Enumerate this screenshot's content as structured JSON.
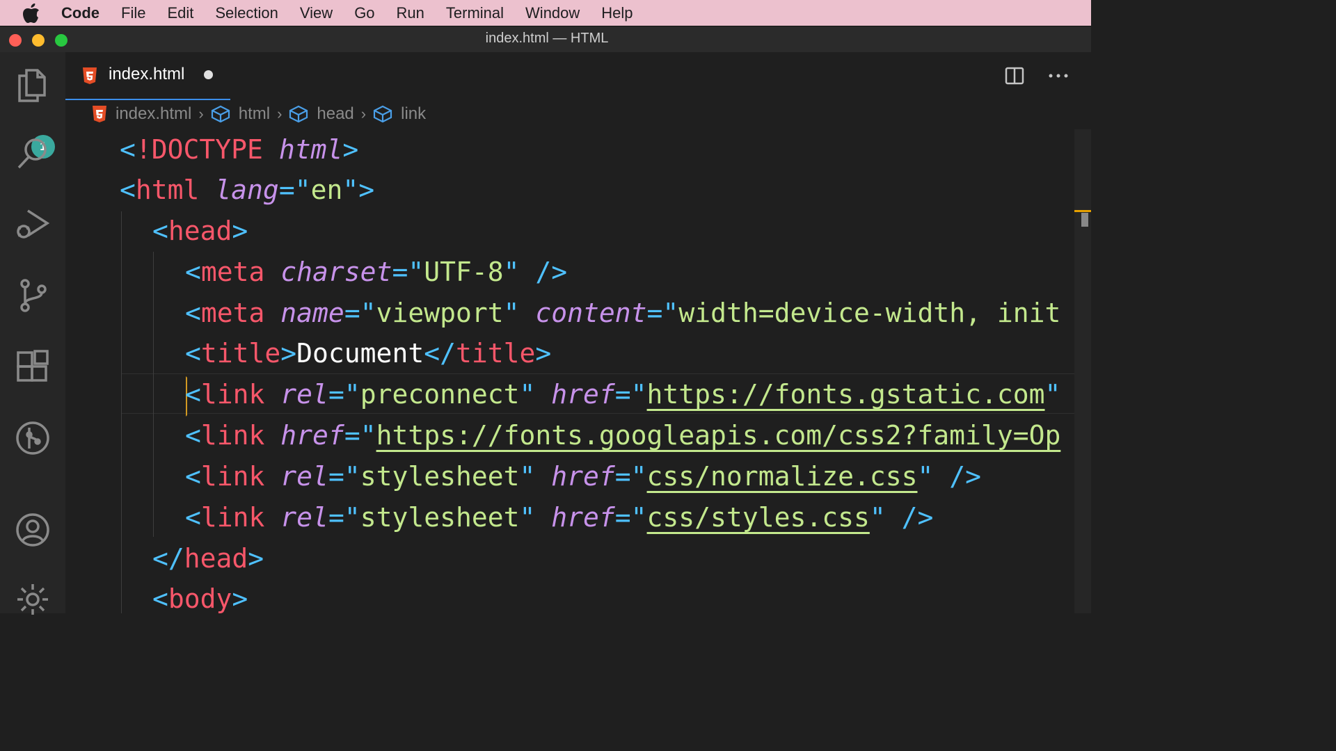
{
  "menubar": {
    "app": "Code",
    "items": [
      "File",
      "Edit",
      "Selection",
      "View",
      "Go",
      "Run",
      "Terminal",
      "Window",
      "Help"
    ]
  },
  "window": {
    "title": "index.html — HTML"
  },
  "activity_bar": {
    "explorer_badge": "1",
    "icons": [
      "files-icon",
      "search-icon",
      "run-debug-icon",
      "source-control-icon",
      "extensions-icon",
      "git-graph-icon",
      "account-icon",
      "gear-icon"
    ]
  },
  "tab": {
    "label": "index.html",
    "modified": true
  },
  "breadcrumb": {
    "file": "index.html",
    "items": [
      "html",
      "head",
      "link"
    ]
  },
  "code_lines": [
    "<!DOCTYPE html>",
    "<html lang=\"en\">",
    "<head>",
    "<meta charset=\"UTF-8\" />",
    "<meta name=\"viewport\" content=\"width=device-width, init",
    "<title>Document</title>",
    "<link rel=\"preconnect\" href=\"https://fonts.gstatic.com\"",
    "<link href=\"https://fonts.googleapis.com/css2?family=Op",
    "<link rel=\"stylesheet\" href=\"css/normalize.css\" />",
    "<link rel=\"stylesheet\" href=\"css/styles.css\" />",
    "</head>",
    "<body>"
  ],
  "tokens": {
    "doctype": "!DOCTYPE",
    "html": "html",
    "lang": "lang",
    "en": "en",
    "head": "head",
    "meta": "meta",
    "charset": "charset",
    "utf8": "UTF-8",
    "name": "name",
    "viewport": "viewport",
    "content": "content",
    "content_val": "width=device-width, init",
    "title": "title",
    "document": "Document",
    "link": "link",
    "rel": "rel",
    "href": "href",
    "preconnect": "preconnect",
    "gstatic": "https://fonts.gstatic.com",
    "googleapis": "https://fonts.googleapis.com/css2?family=Op",
    "stylesheet": "stylesheet",
    "normalize": "css/normalize.css",
    "styles": "css/styles.css",
    "body": "body"
  },
  "colors": {
    "tag": "#f7576a",
    "punctuation": "#4fc1ff",
    "attribute": "#c792ea",
    "string": "#c3e88d",
    "menubar": "#ecc1ce",
    "badge": "#3aa99e"
  }
}
